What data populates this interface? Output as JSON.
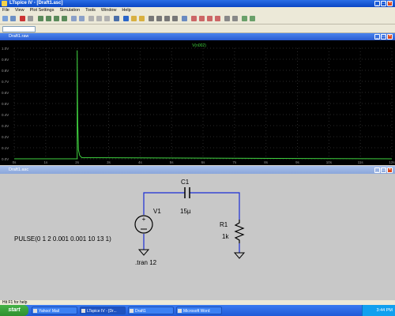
{
  "window": {
    "title": "LTspice IV - [Draft1.asc]"
  },
  "menu": {
    "items": [
      "File",
      "View",
      "Plot Settings",
      "Simulation",
      "Tools",
      "Window",
      "Help"
    ]
  },
  "waveform": {
    "title": "Draft1.raw",
    "trace_label": "V(n002)",
    "y_ticks": [
      "1.0V",
      "0.9V",
      "0.8V",
      "0.7V",
      "0.6V",
      "0.5V",
      "0.4V",
      "0.3V",
      "0.2V",
      "0.1V",
      "0.0V"
    ],
    "x_ticks": [
      "0s",
      "1s",
      "2s",
      "3s",
      "4s",
      "5s",
      "6s",
      "7s",
      "8s",
      "9s",
      "10s",
      "11s",
      "12s"
    ],
    "trace_color": "#3fd13f"
  },
  "schematic": {
    "title": "Draft1.asc",
    "c1_name": "C1",
    "c1_value": "15µ",
    "v1_name": "V1",
    "v1_value": "PULSE(0 1 2 0.001 0.001 10 13 1)",
    "r1_name": "R1",
    "r1_value": "1k",
    "directive": ".tran 12"
  },
  "status": {
    "text": "Hit F1 for help"
  },
  "taskbar": {
    "start": "start",
    "buttons": [
      "Yahoo! Mail",
      "LTspice IV - [Dr...",
      "Draft1",
      "Microsoft Word"
    ],
    "clock": "3:44 PM"
  }
}
